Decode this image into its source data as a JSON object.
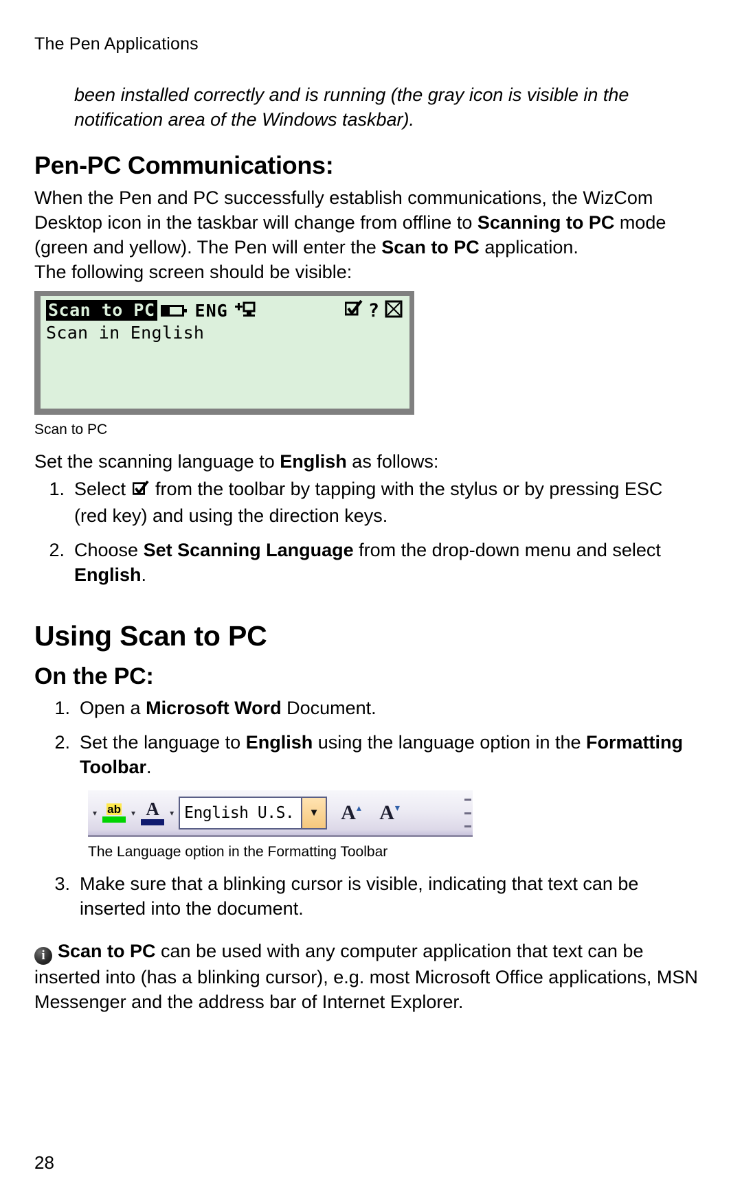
{
  "page": {
    "running_head": "The Pen Applications",
    "folio": "28"
  },
  "continuation": "been installed correctly and is running (the gray icon is visible in the notification area of the Windows taskbar).",
  "pen_pc": {
    "heading": "Pen-PC Communications:",
    "para_1a": "When the Pen and PC successfully establish communications, the WizCom Desktop icon in the taskbar will change from offline to ",
    "para_1b": "Scanning to PC",
    "para_1c": " mode (green and yellow). The Pen will enter the ",
    "para_1d": "Scan to PC",
    "para_1e": " application.",
    "para_2": "The following screen should be visible:"
  },
  "lcd": {
    "app_title": "Scan to PC",
    "battery_icon": "battery-icon",
    "language": "ENG",
    "connect_icon": "pc-connect-icon",
    "toolbar_icon": "checkbox-pen-icon",
    "help_label": "?",
    "close_icon": "close-box-icon",
    "body_text": "Scan in English",
    "screen_color": "#dcf0dc",
    "bezel_color": "#808080",
    "caption": "Scan to PC"
  },
  "set_language": {
    "intro_a": "Set the scanning language to ",
    "intro_b": "English",
    "intro_c": " as follows:",
    "steps": [
      {
        "num": "1.",
        "pre": "Select ",
        "icon": "checkbox-pen-icon",
        "post": " from the toolbar by tapping with the stylus or by pressing ESC (red key) and using the direction keys."
      },
      {
        "num": "2.",
        "pre": "Choose ",
        "bold": "Set Scanning Language",
        "mid": " from the drop-down menu and select ",
        "bold2": "English",
        "post": "."
      }
    ]
  },
  "using": {
    "heading": "Using Scan to PC",
    "subheading": "On the PC:",
    "steps": [
      {
        "num": "1.",
        "pre": "Open a ",
        "bold": "Microsoft Word",
        "post": " Document."
      },
      {
        "num": "2.",
        "pre": "Set the language to ",
        "bold": "English",
        "mid": " using the language option in the ",
        "bold2": "Formatting Toolbar",
        "post": "."
      },
      {
        "num": "3.",
        "pre": "Make sure that a blinking cursor is visible, indicating that text can be inserted into the document.",
        "bold": "",
        "post": ""
      }
    ]
  },
  "word_toolbar": {
    "highlight_icon_label": "ab",
    "highlight_swatch": "#00d400",
    "font_color_letter": "A",
    "font_color_swatch": "#101a6e",
    "language_value": "English U.S.",
    "dropdown_caret": "▼",
    "grow_font_letter": "A",
    "shrink_font_letter": "A",
    "caption": "The Language option in the Formatting Toolbar"
  },
  "note": {
    "icon": "info-icon",
    "bold": "Scan to PC",
    "text": " can be used with any computer application that text can be inserted into (has a blinking cursor), e.g. most Microsoft Office applications, MSN Messenger and the address bar of Internet Explorer."
  }
}
